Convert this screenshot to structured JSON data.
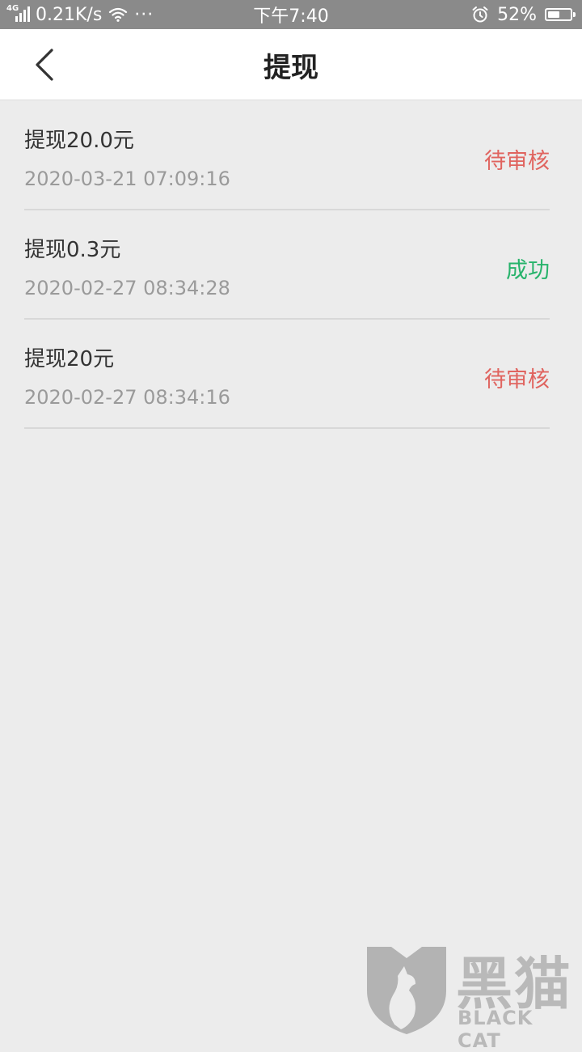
{
  "status_bar": {
    "network_type": "4G",
    "net_speed": "0.21K/s",
    "more": "···",
    "time": "下午7:40",
    "battery_percent": "52%",
    "battery_level": 0.52,
    "icons": [
      "signal-icon",
      "wifi-icon",
      "alarm-icon",
      "battery-icon"
    ]
  },
  "header": {
    "title": "提现",
    "back_icon": "chevron-left-icon"
  },
  "records": [
    {
      "title": "提现20.0元",
      "time": "2020-03-21 07:09:16",
      "status": "待审核",
      "status_color": "#e0645f"
    },
    {
      "title": "提现0.3元",
      "time": "2020-02-27 08:34:28",
      "status": "成功",
      "status_color": "#27b36b"
    },
    {
      "title": "提现20元",
      "time": "2020-02-27 08:34:16",
      "status": "待审核",
      "status_color": "#e0645f"
    }
  ],
  "watermark": {
    "chinese": "黑猫",
    "english": "BLACK CAT"
  }
}
